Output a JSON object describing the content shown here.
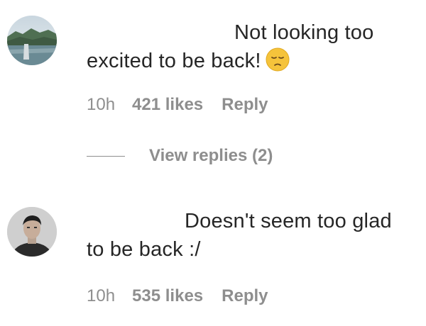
{
  "comments": [
    {
      "text_line1": "Not looking too",
      "text_line2": "excited to be back!",
      "emoji": "pensive-face-emoji",
      "time": "10h",
      "likes": "421 likes",
      "reply": "Reply",
      "view_replies": "View replies (2)"
    },
    {
      "text_line1": "Doesn't seem too glad",
      "text_line2": "to be back :/",
      "time": "10h",
      "likes": "535 likes",
      "reply": "Reply"
    }
  ],
  "colors": {
    "text": "#262626",
    "meta": "#8e8e8e",
    "emoji": "#f5c33b"
  }
}
